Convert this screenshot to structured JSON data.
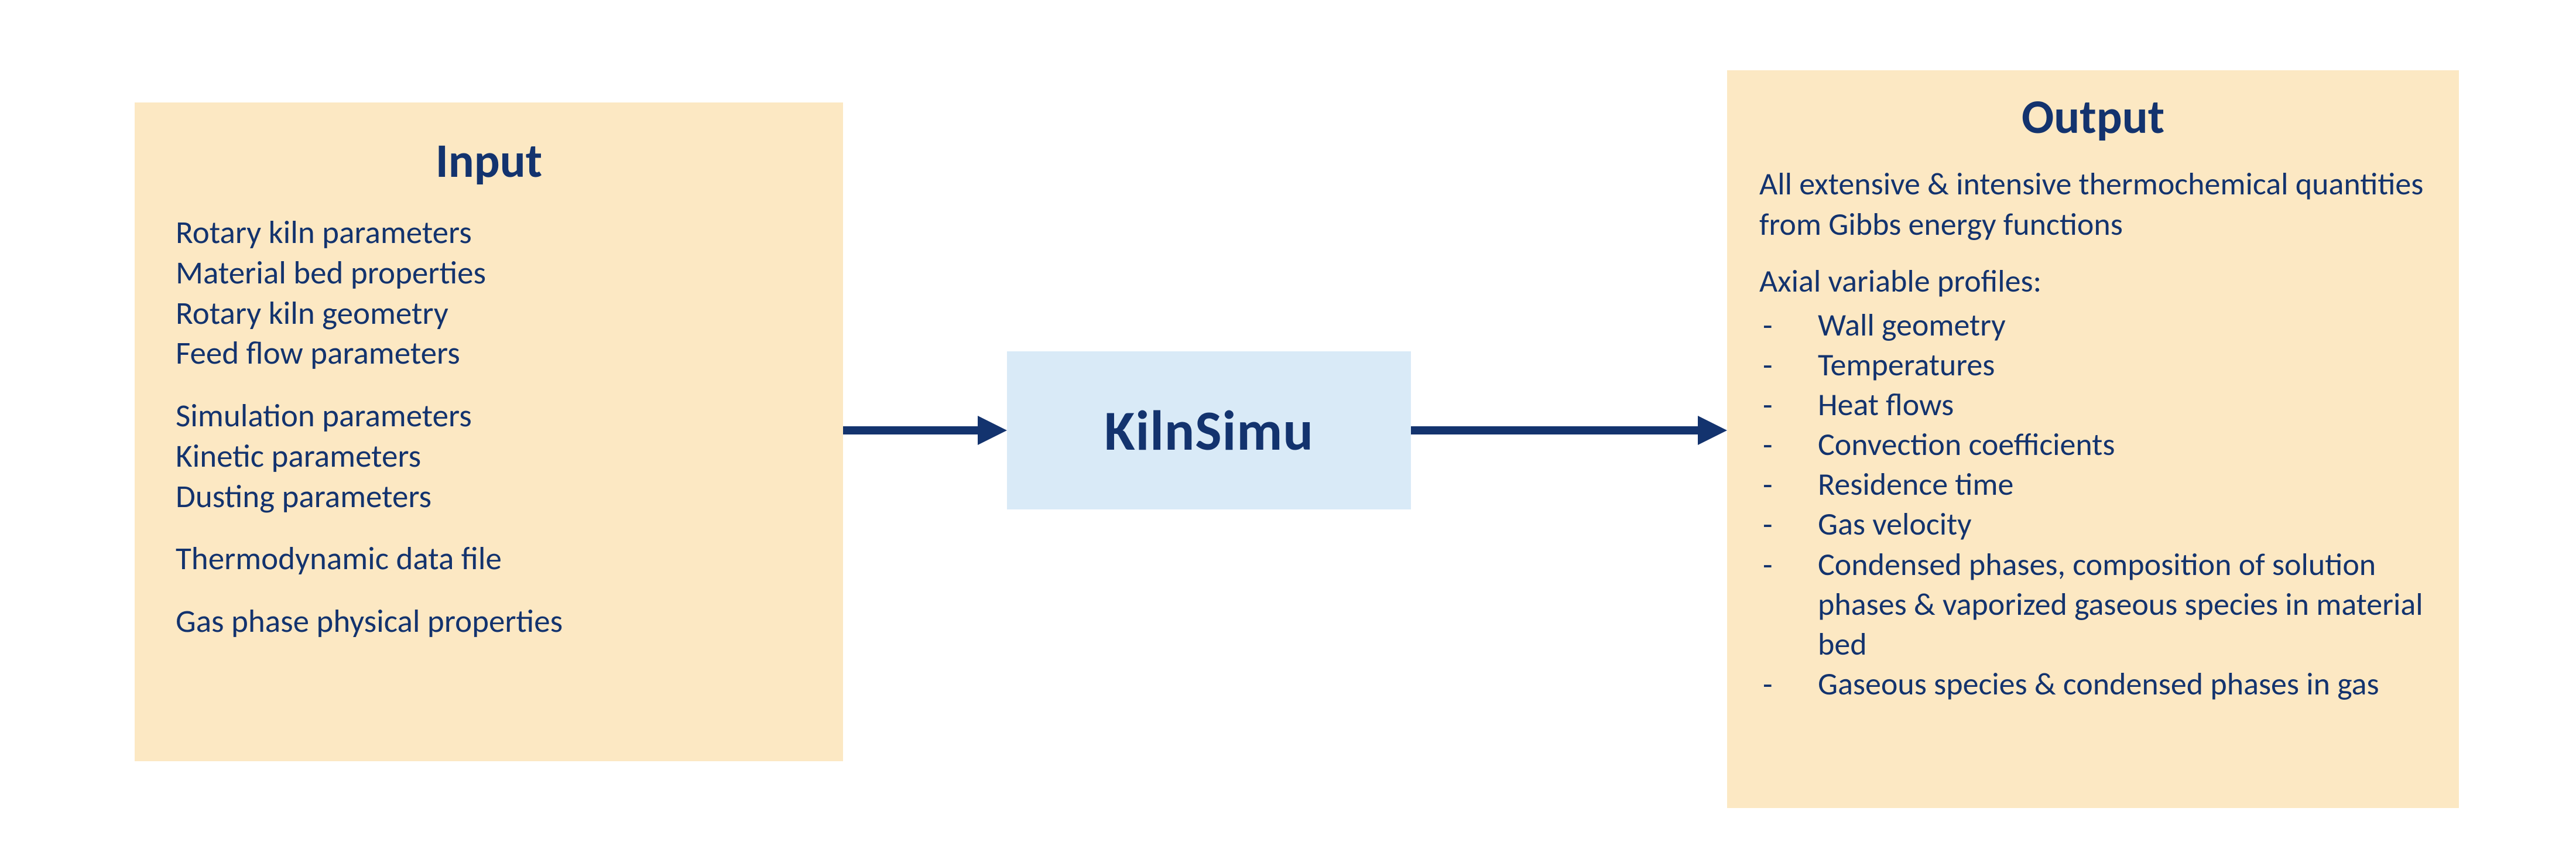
{
  "diagram": {
    "center_label": "KilnSimu",
    "input": {
      "title": "Input",
      "group1": [
        "Rotary kiln parameters",
        "Material bed properties",
        "Rotary kiln geometry",
        "Feed flow parameters"
      ],
      "group2": [
        "Simulation parameters",
        "Kinetic parameters",
        "Dusting parameters"
      ],
      "group3": [
        "Thermodynamic data file"
      ],
      "group4": [
        "Gas phase physical properties"
      ]
    },
    "output": {
      "title": "Output",
      "paragraph": "All extensive & intensive thermochemical quantities from Gibbs energy functions",
      "profiles_heading": "Axial variable profiles:",
      "profiles": [
        "Wall geometry",
        "Temperatures",
        "Heat flows",
        "Convection coefficients",
        "Residence time",
        "Gas velocity",
        "Condensed phases, composition of solution phases & vaporized gaseous species in material bed",
        "Gaseous species & condensed phases in gas"
      ]
    },
    "colors": {
      "panel_bg": "#fce8c3",
      "center_bg": "#d9eaf7",
      "text": "#13336e",
      "arrow": "#13336e"
    }
  }
}
